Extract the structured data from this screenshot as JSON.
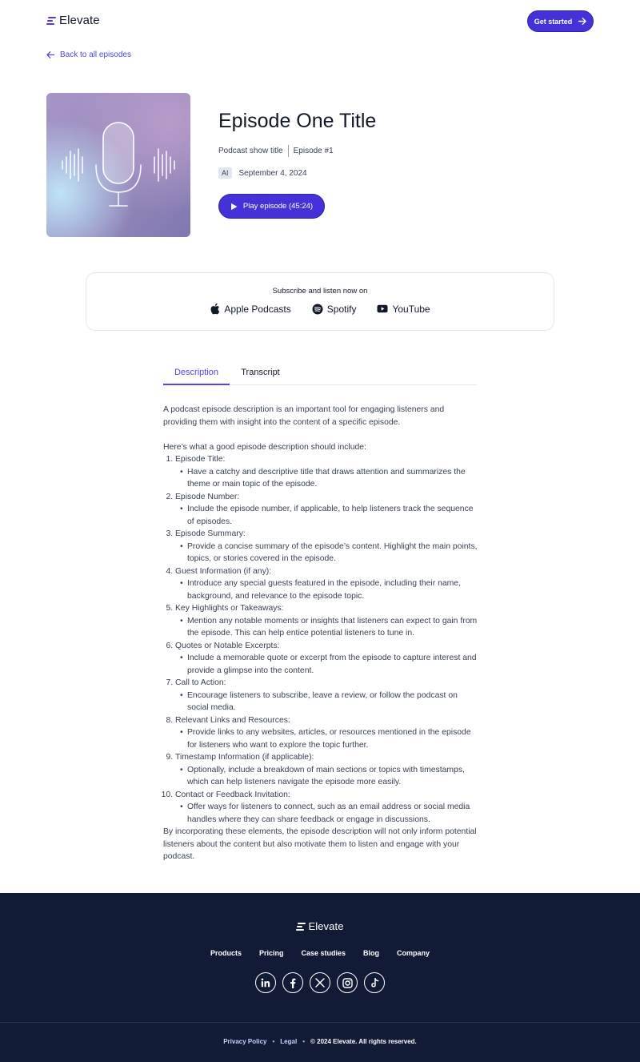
{
  "header": {
    "logo_text": "Elevate",
    "cta_label": "Get started"
  },
  "nav": {
    "back_label": "Back to all episodes"
  },
  "episode": {
    "title": "Episode One Title",
    "show_title": "Podcast show title",
    "episode_number": "Episode #1",
    "badge": "AI",
    "date": "September 4, 2024",
    "play_label": "Play episode (45:24)"
  },
  "subscribe": {
    "title": "Subscribe and listen now on",
    "platforms": [
      {
        "label": "Apple Podcasts",
        "icon": "apple-icon"
      },
      {
        "label": "Spotify",
        "icon": "spotify-icon"
      },
      {
        "label": "YouTube",
        "icon": "youtube-icon"
      }
    ]
  },
  "tabs": [
    {
      "label": "Description",
      "active": true
    },
    {
      "label": "Transcript",
      "active": false
    }
  ],
  "description": {
    "intro": "A podcast episode description is an important tool for engaging listeners and providing them with insight into the content of a specific episode.",
    "list_heading": "Here’s what a good episode description should include:",
    "items": [
      {
        "title": "Episode Title:",
        "detail": "Have a catchy and descriptive title that draws attention and summarizes the theme or main topic of the episode."
      },
      {
        "title": "Episode Number:",
        "detail": "Include the episode number, if applicable, to help listeners track the sequence of episodes."
      },
      {
        "title": "Episode Summary:",
        "detail": "Provide a concise summary of the episode’s content. Highlight the main points, topics, or stories covered in the episode."
      },
      {
        "title": "Guest Information (if any):",
        "detail": "Introduce any special guests featured in the episode, including their name, background, and relevance to the episode topic."
      },
      {
        "title": "Key Highlights or Takeaways:",
        "detail": "Mention any notable moments or insights that listeners can expect to gain from the episode. This can help entice potential listeners to tune in."
      },
      {
        "title": "Quotes or Notable Excerpts:",
        "detail": "Include a memorable quote or excerpt from the episode to capture interest and provide a glimpse into the content."
      },
      {
        "title": "Call to Action:",
        "detail": "Encourage listeners to subscribe, leave a review, or follow the podcast on social media."
      },
      {
        "title": "Relevant Links and Resources:",
        "detail": "Provide links to any websites, articles, or resources mentioned in the episode for listeners who want to explore the topic further."
      },
      {
        "title": "Timestamp Information (if applicable):",
        "detail": "Optionally, include a breakdown of main sections or topics with timestamps, which can help listeners navigate the episode more easily."
      },
      {
        "title": "Contact or Feedback Invitation:",
        "detail": "Offer ways for listeners to connect, such as an email address or social media handles where they can share feedback or engage in discussions."
      }
    ],
    "closing": "By incorporating these elements, the episode description will not only inform potential listeners about the content but also motivate them to listen and engage with your podcast."
  },
  "footer": {
    "logo_text": "Elevate",
    "nav": [
      "Products",
      "Pricing",
      "Case studies",
      "Blog",
      "Company"
    ],
    "socials": [
      "linkedin-icon",
      "facebook-icon",
      "x-icon",
      "instagram-icon",
      "tiktok-icon"
    ],
    "privacy_label": "Privacy Policy",
    "legal_label": "Legal",
    "copyright": "© 2024 Elevate. All rights reserved."
  },
  "colors": {
    "accent": "#4531d8",
    "footer_bg": "#111b35",
    "link": "#4f46e5"
  }
}
